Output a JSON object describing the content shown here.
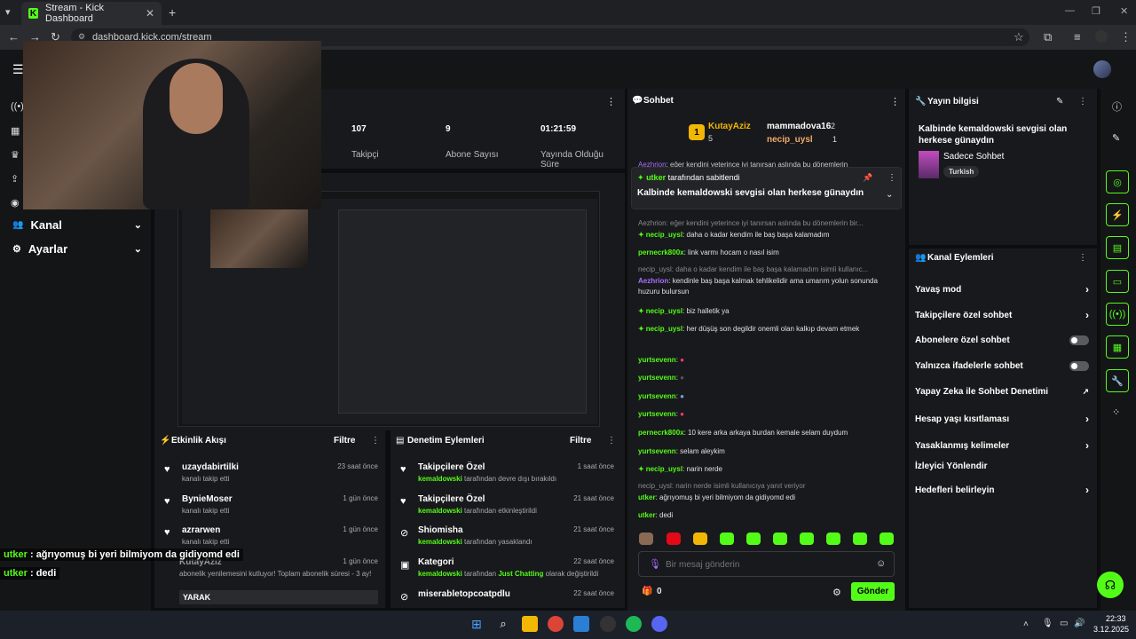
{
  "browser": {
    "tab_title": "Stream - Kick Dashboard",
    "url": "dashboard.kick.com/stream"
  },
  "leftnav": {
    "kanal": "Kanal",
    "ayarlar": "Ayarlar"
  },
  "stats": [
    {
      "value": "107",
      "label": "Takipçi"
    },
    {
      "value": "9",
      "label": "Abone Sayısı"
    },
    {
      "value": "01:21:59",
      "label": "Yayında Olduğu Süre"
    }
  ],
  "activity": {
    "title": "Etkinlik Akışı",
    "filter": "Filtre",
    "items": [
      {
        "name": "uzaydabirtilki",
        "sub": "kanalı takip etti",
        "time": "23 saat önce"
      },
      {
        "name": "BynieMoser",
        "sub": "kanalı takip etti",
        "time": "1 gün önce"
      },
      {
        "name": "azrarwen",
        "sub": "kanalı takip etti",
        "time": "1 gün önce"
      },
      {
        "name": "KutayAziz",
        "sub": "abonelik yenilemesini kutluyor! Toplam abonelik süresi - 3 ay!",
        "time": "1 gün önce"
      }
    ],
    "footer_label": "YARAK"
  },
  "moderation": {
    "title": "Denetim Eylemleri",
    "filter": "Filtre",
    "items": [
      {
        "title": "Takipçilere Özel",
        "user": "kemaldowski",
        "rest": "tarafından devre dışı bırakıldı",
        "time": "1 saat önce"
      },
      {
        "title": "Takipçilere Özel",
        "user": "kemaldowski",
        "rest": "tarafından etkinleştirildi",
        "time": "21 saat önce"
      },
      {
        "title": "Shiomisha",
        "user": "kemaldowski",
        "rest": "tarafından yasaklandı",
        "time": "21 saat önce"
      },
      {
        "title": "Kategori",
        "user": "kemaldowski",
        "rest": "tarafından",
        "extra": "Just Chatting",
        "rest2": "olarak değiştirildi",
        "time": "22 saat önce"
      },
      {
        "title": "miserabletopcoatpdlu",
        "user": "",
        "rest": "",
        "time": "22 saat önce"
      }
    ]
  },
  "chat": {
    "title": "Sohbet",
    "leader1": {
      "rank": "1",
      "name": "KutayAziz",
      "count": "5"
    },
    "leader2": {
      "name": "mammadova16",
      "count": "2"
    },
    "leader3": {
      "name": "necip_uysl",
      "count": "1"
    },
    "pinned_by_user": "utker",
    "pinned_by_text": "tarafından sabitlendi",
    "pinned_message": "Kalbinde kemaldowski sevgisi olan herkese günaydın",
    "peek_user": "Aezhrion",
    "peek_text": "eğer kendini yeterince iyi tanırsan aslında bu dönemlerin",
    "messages": [
      {
        "reply": "Aezhrion: eğer kendini yeterince iyi tanırsan aslında bu dönemlerin bir..."
      },
      {
        "user": "necip_uysl",
        "text": "daha o kadar kendim ile baş başa kalamadım",
        "star": true
      },
      {
        "user": "pernecrk800x",
        "text": "link varmı hocam o nasıl isim"
      },
      {
        "reply": "necip_uysl: daha o kadar kendim ile baş başa kalamadım isimli kullanıc..."
      },
      {
        "user": "Aezhrion",
        "text": "kendinle baş başa kalmak tehlikelidir ama umarım yolun sonunda huzuru bulursun"
      },
      {
        "user": "necip_uysl",
        "text": "biz halletik ya",
        "star": true
      },
      {
        "user": "necip_uysl",
        "text": "her düşüş son degildir onemli olan kalkıp devam etmek",
        "star": true
      },
      {
        "user": "yurtsevenn",
        "text": ""
      },
      {
        "user": "yurtsevenn",
        "text": ""
      },
      {
        "user": "yurtsevenn",
        "text": ""
      },
      {
        "user": "yurtsevenn",
        "text": ""
      },
      {
        "user": "pernecrk800x",
        "text": "10 kere arka arkaya burdan kemale selam duydum"
      },
      {
        "user": "yurtsevenn",
        "text": "selam aleykim"
      },
      {
        "user": "necip_uysl",
        "text": "narin nerde",
        "star": true
      },
      {
        "reply": "necip_uysl: narin nerde isimli kullanıcıya yanıt veriyor"
      },
      {
        "user": "utker",
        "text": "ağrıyomuş bi yeri bilmiyom da gidiyomd edi"
      },
      {
        "user": "utker",
        "text": "dedi"
      }
    ],
    "input_placeholder": "Bir mesaj gönderin",
    "points": "0",
    "send": "Gönder"
  },
  "stream_info": {
    "title": "Yayın bilgisi",
    "stream_title": "Kalbinde kemaldowski sevgisi olan herkese günaydın",
    "category": "Sadece Sohbet",
    "tag": "Turkish"
  },
  "channel_actions": {
    "title": "Kanal Eylemleri",
    "items": [
      {
        "label": "Yavaş mod",
        "kind": "chevron"
      },
      {
        "label": "Takipçilere özel sohbet",
        "kind": "chevron"
      },
      {
        "label": "Abonelere özel sohbet",
        "kind": "toggle"
      },
      {
        "label": "Yalnızca ifadelerle sohbet",
        "kind": "toggle"
      },
      {
        "label": "Yapay Zeka ile Sohbet Denetimi",
        "kind": "external"
      },
      {
        "label": "Hesap yaşı kısıtlaması",
        "kind": "chevron"
      },
      {
        "label": "Yasaklanmış kelimeler",
        "kind": "chevron"
      },
      {
        "label": "İzleyici Yönlendir",
        "kind": "none"
      },
      {
        "label": "Hedefleri belirleyin",
        "kind": "chevron"
      }
    ]
  },
  "overlay": [
    {
      "user": "utker",
      "text": "ağrıyomuş bi yeri bilmiyom da gidiyomd edi"
    },
    {
      "user": "utker",
      "text": "dedi"
    }
  ],
  "clock": {
    "time": "22:33",
    "date": "3.12.2025"
  },
  "colors": {
    "accent": "#53fc18",
    "purple": "#a970ff",
    "bg": "#0b0d0f",
    "panel": "#18191c"
  }
}
